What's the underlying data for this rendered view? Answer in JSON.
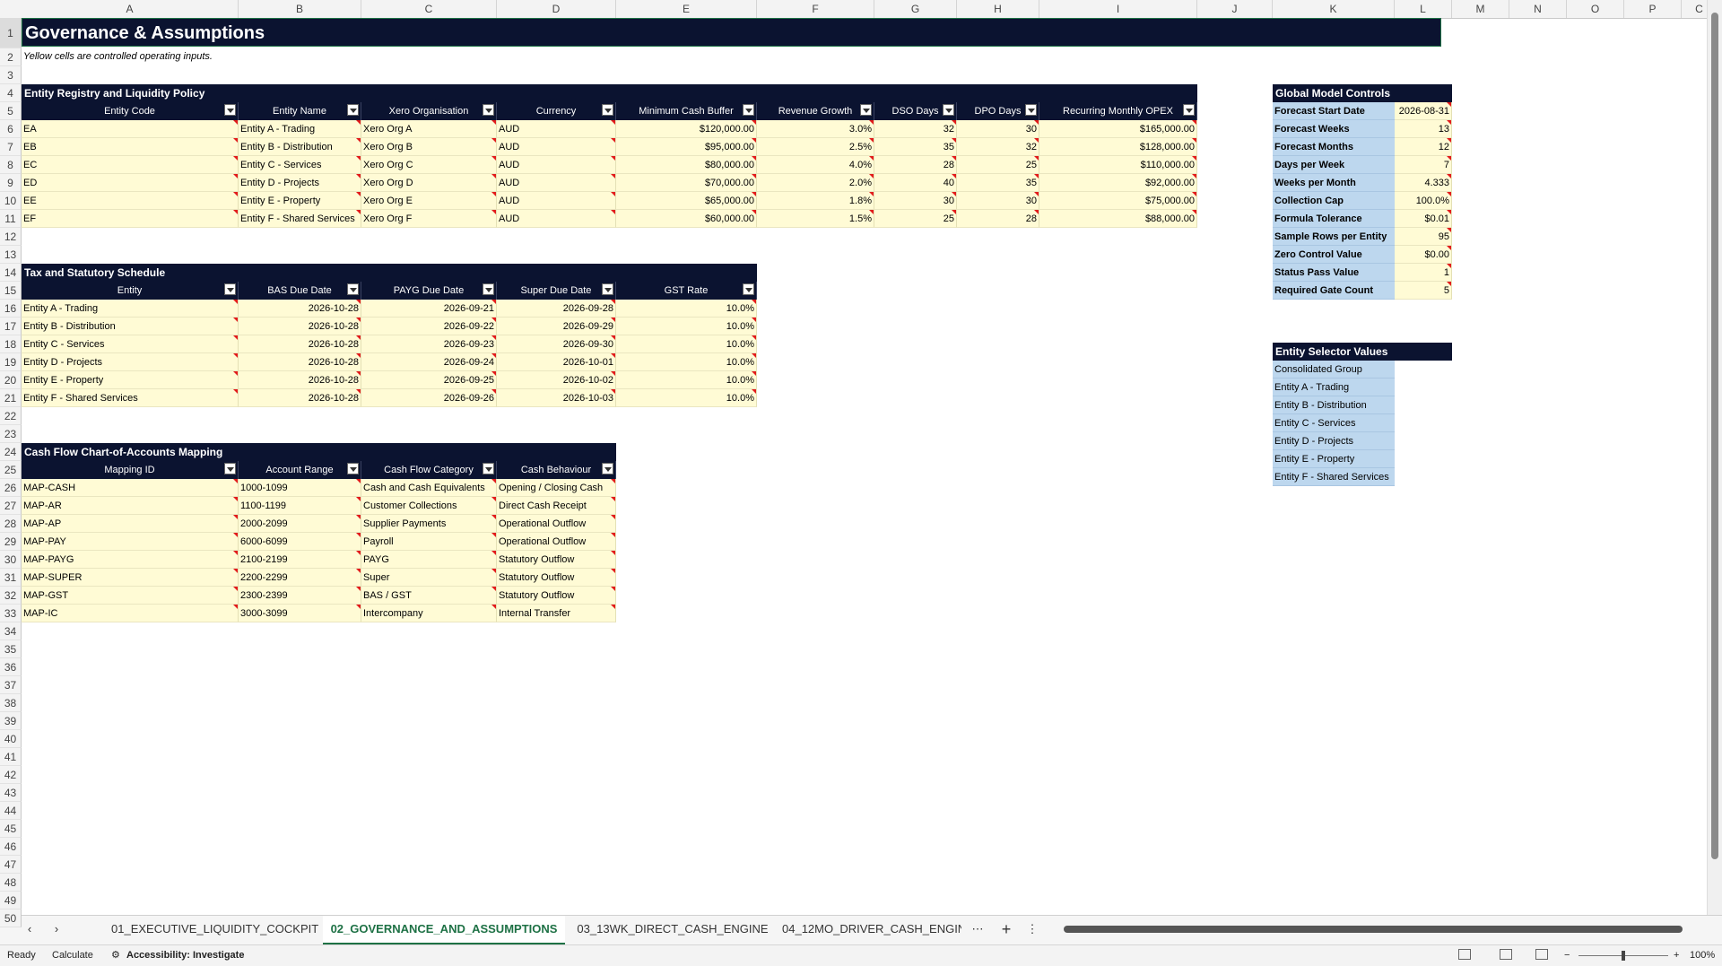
{
  "columns": [
    "A",
    "B",
    "C",
    "D",
    "E",
    "F",
    "G",
    "H",
    "I",
    "J",
    "K",
    "L",
    "M",
    "N",
    "O",
    "P",
    "C"
  ],
  "rows": [
    "1",
    "2",
    "3",
    "4",
    "5",
    "6",
    "7",
    "8",
    "9",
    "10",
    "11",
    "12",
    "13",
    "14",
    "15",
    "16",
    "17",
    "18",
    "19",
    "20",
    "21",
    "22",
    "23",
    "24",
    "25",
    "26",
    "27",
    "28",
    "29",
    "30",
    "31",
    "32",
    "33",
    "34",
    "35",
    "36",
    "37",
    "38",
    "39",
    "40",
    "41",
    "42",
    "43",
    "44",
    "45",
    "46",
    "47",
    "48",
    "49",
    "50"
  ],
  "sheet": {
    "title": "Governance & Assumptions",
    "note": "Yellow cells are controlled operating inputs."
  },
  "entity_registry": {
    "title": "Entity Registry and Liquidity Policy",
    "headers": [
      "Entity Code",
      "Entity Name",
      "Xero Organisation",
      "Currency",
      "Minimum Cash Buffer",
      "Revenue Growth",
      "DSO Days",
      "DPO Days",
      "Recurring Monthly OPEX"
    ],
    "rows": [
      [
        "EA",
        "Entity A - Trading",
        "Xero Org A",
        "AUD",
        "$120,000.00",
        "3.0%",
        "32",
        "30",
        "$165,000.00"
      ],
      [
        "EB",
        "Entity B - Distribution",
        "Xero Org B",
        "AUD",
        "$95,000.00",
        "2.5%",
        "35",
        "32",
        "$128,000.00"
      ],
      [
        "EC",
        "Entity C - Services",
        "Xero Org C",
        "AUD",
        "$80,000.00",
        "4.0%",
        "28",
        "25",
        "$110,000.00"
      ],
      [
        "ED",
        "Entity D - Projects",
        "Xero Org D",
        "AUD",
        "$70,000.00",
        "2.0%",
        "40",
        "35",
        "$92,000.00"
      ],
      [
        "EE",
        "Entity E - Property",
        "Xero Org E",
        "AUD",
        "$65,000.00",
        "1.8%",
        "30",
        "30",
        "$75,000.00"
      ],
      [
        "EF",
        "Entity F - Shared Services",
        "Xero Org F",
        "AUD",
        "$60,000.00",
        "1.5%",
        "25",
        "28",
        "$88,000.00"
      ]
    ]
  },
  "tax_schedule": {
    "title": "Tax and Statutory Schedule",
    "headers": [
      "Entity",
      "BAS Due Date",
      "PAYG Due Date",
      "Super Due Date",
      "GST Rate"
    ],
    "rows": [
      [
        "Entity A - Trading",
        "2026-10-28",
        "2026-09-21",
        "2026-09-28",
        "10.0%"
      ],
      [
        "Entity B - Distribution",
        "2026-10-28",
        "2026-09-22",
        "2026-09-29",
        "10.0%"
      ],
      [
        "Entity C - Services",
        "2026-10-28",
        "2026-09-23",
        "2026-09-30",
        "10.0%"
      ],
      [
        "Entity D - Projects",
        "2026-10-28",
        "2026-09-24",
        "2026-10-01",
        "10.0%"
      ],
      [
        "Entity E - Property",
        "2026-10-28",
        "2026-09-25",
        "2026-10-02",
        "10.0%"
      ],
      [
        "Entity F - Shared Services",
        "2026-10-28",
        "2026-09-26",
        "2026-10-03",
        "10.0%"
      ]
    ]
  },
  "coa_mapping": {
    "title": "Cash Flow Chart-of-Accounts Mapping",
    "headers": [
      "Mapping ID",
      "Account Range",
      "Cash Flow Category",
      "Cash Behaviour"
    ],
    "rows": [
      [
        "MAP-CASH",
        "1000-1099",
        "Cash and Cash Equivalents",
        "Opening / Closing Cash"
      ],
      [
        "MAP-AR",
        "1100-1199",
        "Customer Collections",
        "Direct Cash Receipt"
      ],
      [
        "MAP-AP",
        "2000-2099",
        "Supplier Payments",
        "Operational Outflow"
      ],
      [
        "MAP-PAY",
        "6000-6099",
        "Payroll",
        "Operational Outflow"
      ],
      [
        "MAP-PAYG",
        "2100-2199",
        "PAYG",
        "Statutory Outflow"
      ],
      [
        "MAP-SUPER",
        "2200-2299",
        "Super",
        "Statutory Outflow"
      ],
      [
        "MAP-GST",
        "2300-2399",
        "BAS / GST",
        "Statutory Outflow"
      ],
      [
        "MAP-IC",
        "3000-3099",
        "Intercompany",
        "Internal Transfer"
      ]
    ]
  },
  "global_controls": {
    "title": "Global Model Controls",
    "rows": [
      [
        "Forecast Start Date",
        "2026-08-31"
      ],
      [
        "Forecast Weeks",
        "13"
      ],
      [
        "Forecast Months",
        "12"
      ],
      [
        "Days per Week",
        "7"
      ],
      [
        "Weeks per Month",
        "4.333"
      ],
      [
        "Collection Cap",
        "100.0%"
      ],
      [
        "Formula Tolerance",
        "$0.01"
      ],
      [
        "Sample Rows per Entity",
        "95"
      ],
      [
        "Zero Control Value",
        "$0.00"
      ],
      [
        "Status Pass Value",
        "1"
      ],
      [
        "Required Gate Count",
        "5"
      ]
    ]
  },
  "entity_selector": {
    "title": "Entity Selector Values",
    "values": [
      "Consolidated Group",
      "Entity A - Trading",
      "Entity B - Distribution",
      "Entity C - Services",
      "Entity D - Projects",
      "Entity E - Property",
      "Entity F - Shared Services"
    ]
  },
  "tabs": [
    "01_EXECUTIVE_LIQUIDITY_COCKPIT",
    "02_GOVERNANCE_AND_ASSUMPTIONS",
    "03_13WK_DIRECT_CASH_ENGINE",
    "04_12MO_DRIVER_CASH_ENGIN"
  ],
  "tab_more": "⋯",
  "status": {
    "ready": "Ready",
    "calculate": "Calculate",
    "accessibility": "Accessibility: Investigate",
    "zoom": "100%"
  }
}
